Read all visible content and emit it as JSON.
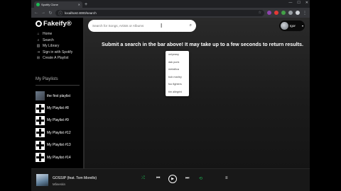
{
  "browser": {
    "tab_title": "Spotify Clone",
    "url": "localhost:4000/search",
    "new_tab_symbol": "+"
  },
  "sidebar": {
    "logo": "Fakeify®",
    "nav": [
      {
        "label": "Home",
        "icon": "home-icon"
      },
      {
        "label": "Search",
        "icon": "search-icon"
      },
      {
        "label": "My Library",
        "icon": "library-icon"
      },
      {
        "label": "Sign in with Spotify",
        "icon": "login-icon"
      },
      {
        "label": "Create A Playlist",
        "icon": "plus-icon"
      }
    ],
    "section_title": "My Playlists",
    "playlists": [
      "the first playlist",
      "My Playlist #8",
      "My Playlist #9",
      "My Playlist #12",
      "My Playlist #13",
      "My Playlist #14"
    ]
  },
  "search": {
    "placeholder": "Search for Songs, Artists or Albums",
    "message": "Submit a search in the bar above! It may take up to a few seconds to return results.",
    "suggestions": [
      "onlyeasy",
      "dak punk",
      "metallica",
      "bob marley",
      "foo fighters",
      "tim allegrini"
    ]
  },
  "user": {
    "name": "Igor"
  },
  "player": {
    "song": "GOSSIP (feat. Tom Morello)",
    "artist": "Måneskin",
    "accent": "#1db954"
  }
}
